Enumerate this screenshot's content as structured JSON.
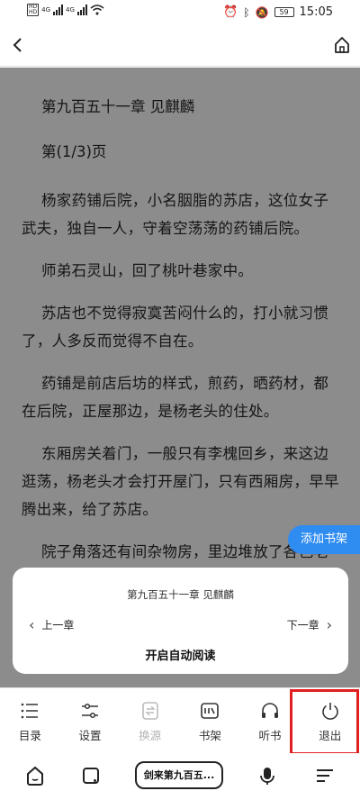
{
  "status_bar": {
    "sim1": [
      "HD",
      "HD"
    ],
    "net1": "4G",
    "net2": "4G",
    "battery": "59",
    "time": "15:05"
  },
  "nav": {
    "back_icon": "chevron-left-icon",
    "home_icon": "home-icon"
  },
  "reader": {
    "chapter_title": "第九百五十一章 见麒麟",
    "page_no": "第(1/3)页",
    "paragraphs": [
      "杨家药铺后院，小名胭脂的苏店，这位女子武夫，独自一人，守着空荡荡的药铺后院。",
      "师弟石灵山，回了桃叶巷家中。",
      "苏店也不觉得寂寞苦闷什么的，打小就习惯了，人多反而觉得不自在。",
      "药铺是前店后坊的样式，煎药，晒药材，都在后院，正屋那边，是杨老头的住处。",
      "东厢房关着门，一般只有李槐回乡，来这边逛荡，杨老头才会打开屋门，只有西厢房，早早腾出来，给了苏店。",
      "院子角落还有间杂物房，里边堆放了各色老物件，都留给他了，是卖是送都随意。"
    ]
  },
  "add_shelf": "添加书架",
  "card": {
    "title": "第九百五十一章 见麒麟",
    "prev": "上一章",
    "next": "下一章",
    "auto_read": "开启自动阅读"
  },
  "toolbar": [
    {
      "label": "目录",
      "icon": "list-icon"
    },
    {
      "label": "设置",
      "icon": "sliders-icon"
    },
    {
      "label": "换源",
      "icon": "swap-source-icon"
    },
    {
      "label": "书架",
      "icon": "bookshelf-icon"
    },
    {
      "label": "听书",
      "icon": "headphones-icon"
    },
    {
      "label": "退出",
      "icon": "power-icon"
    }
  ],
  "browser": {
    "url_text": "剑来第九百五..."
  },
  "colors": {
    "overlay": "#8c8c8c",
    "accent": "#2f8cf0",
    "highlight": "#e02020"
  }
}
